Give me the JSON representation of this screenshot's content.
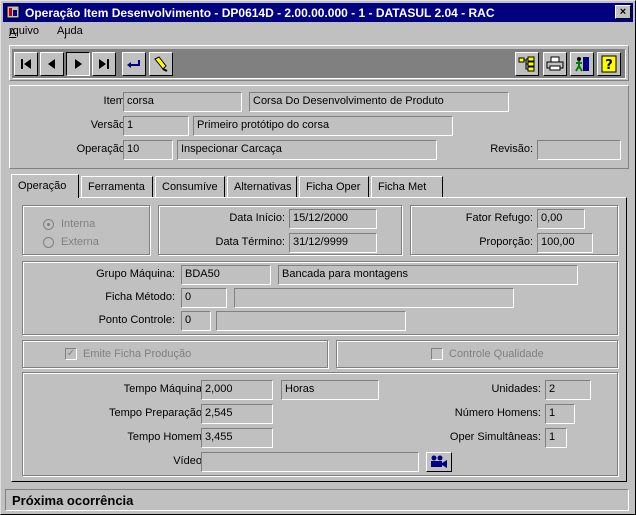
{
  "window": {
    "title": "Operação Item Desenvolvimento - DP0614D - 2.00.00.000 - 1 - DATASUL 2.04 - RAC",
    "close_label": "×"
  },
  "menu": {
    "arquivo": "Arquivo",
    "ajuda": "Ajuda"
  },
  "header": {
    "item_label": "Item:",
    "item_code": "corsa",
    "item_desc": "Corsa Do Desenvolvimento de Produto",
    "versao_label": "Versão:",
    "versao_code": "1",
    "versao_desc": "Primeiro protótipo do corsa",
    "operacao_label": "Operação:",
    "operacao_code": "10",
    "operacao_desc": "Inspecionar Carcaça",
    "revisao_label": "Revisão:",
    "revisao_value": ""
  },
  "tabs": [
    {
      "label": "Operação",
      "active": true
    },
    {
      "label": "Ferramenta"
    },
    {
      "label": "Consumíve"
    },
    {
      "label": "Alternativas"
    },
    {
      "label": "Ficha Oper"
    },
    {
      "label": "Ficha Met"
    }
  ],
  "operacao_tab": {
    "radio_interna": "Interna",
    "radio_externa": "Externa",
    "data_inicio_label": "Data Início:",
    "data_inicio": "15/12/2000",
    "data_termino_label": "Data Término:",
    "data_termino": "31/12/9999",
    "fator_refugo_label": "Fator Refugo:",
    "fator_refugo": "0,00",
    "proporcao_label": "Proporção:",
    "proporcao": "100,00",
    "grupo_maquina_label": "Grupo Máquina:",
    "grupo_maquina_code": "BDA50",
    "grupo_maquina_desc": "Bancada para montagens",
    "ficha_metodo_label": "Ficha Método:",
    "ficha_metodo_code": "0",
    "ficha_metodo_desc": "",
    "ponto_controle_label": "Ponto Controle:",
    "ponto_controle_code": "0",
    "ponto_controle_desc": "",
    "emite_ficha_label": "Emite Ficha Produção",
    "controle_qualidade_label": "Controle Qualidade",
    "tempo_maquina_label": "Tempo Máquina:",
    "tempo_maquina": "2,000",
    "unidade_tempo": "Horas",
    "tempo_preparacao_label": "Tempo Preparação:",
    "tempo_preparacao": "2,545",
    "tempo_homem_label": "Tempo Homem:",
    "tempo_homem": "3,455",
    "video_label": "Vídeo:",
    "video_value": "",
    "unidades_label": "Unidades:",
    "unidades": "2",
    "numero_homens_label": "Número Homens:",
    "numero_homens": "1",
    "oper_simultaneas_label": "Oper Simultâneas:",
    "oper_simultaneas": "1"
  },
  "status": {
    "text": "Próxima ocorrência"
  },
  "icons": {
    "first": "first-record-icon",
    "prev": "prev-record-icon",
    "next": "next-record-icon",
    "last": "last-record-icon",
    "goto": "goto-icon",
    "search": "search-icon",
    "tree": "tree-icon",
    "print": "print-icon",
    "exit": "exit-icon",
    "help": "help-icon"
  }
}
